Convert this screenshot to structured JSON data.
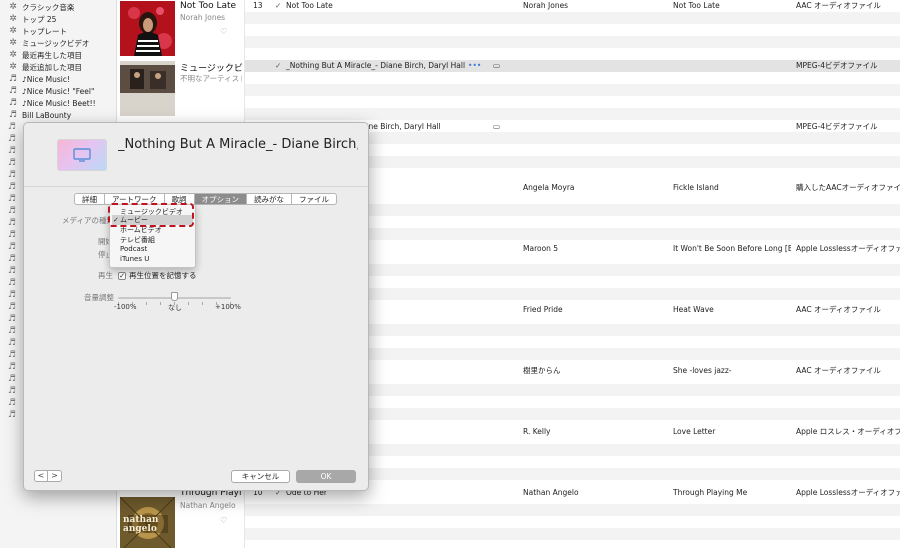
{
  "sidebar": {
    "items": [
      {
        "label": "クラシック音楽",
        "icon": "gear-icon"
      },
      {
        "label": "トップ 25",
        "icon": "gear-icon"
      },
      {
        "label": "トップレート",
        "icon": "gear-icon"
      },
      {
        "label": "ミュージックビデオ",
        "icon": "gear-icon"
      },
      {
        "label": "最近再生した項目",
        "icon": "gear-icon"
      },
      {
        "label": "最近追加した項目",
        "icon": "gear-icon"
      },
      {
        "label": "♪Nice Music!",
        "icon": "playlist-icon"
      },
      {
        "label": "♪Nice Music! \"Feel\"",
        "icon": "playlist-icon"
      },
      {
        "label": "♪Nice Music! Beet!!",
        "icon": "playlist-icon"
      },
      {
        "label": "Bill LaBounty",
        "icon": "playlist-icon"
      }
    ]
  },
  "albums": [
    {
      "title": "Not Too Late",
      "artist": "Norah Jones"
    },
    {
      "title": "ミュージックビデ...",
      "artist": "不明なアーティスト"
    },
    {
      "title": "Through Playin...",
      "artist": "Nathan Angelo",
      "cover_text": "nathan angelo"
    }
  ],
  "tracks": [
    {
      "num": "13",
      "check": "✓",
      "name": "Not Too Late",
      "icon": "",
      "artist": "Norah Jones",
      "album": "Not Too Late",
      "kind": "AAC オーディオファイル"
    },
    {
      "num": "",
      "check": "✓",
      "name": "_Nothing But A Miracle_- Diane Birch, Daryl Hall",
      "dots": "•••",
      "icon": "▭",
      "artist": "",
      "album": "",
      "kind": "MPEG-4ビデオファイル",
      "selected": true
    },
    {
      "num": "",
      "check": "",
      "name": "Diane Birch, Daryl Hall",
      "icon": "▭",
      "artist": "",
      "album": "",
      "kind": "MPEG-4ビデオファイル"
    },
    {
      "num": "",
      "check": "",
      "name": "",
      "icon": "",
      "artist": "Angela Moyra",
      "album": "Fickle Island",
      "kind": "購入したAACオーディオファイル"
    },
    {
      "num": "",
      "check": "",
      "name": "",
      "icon": "",
      "artist": "Maroon 5",
      "album": "It Won't Be Soon Before Long [Bo...",
      "kind": "Apple Losslessオーディオファイル"
    },
    {
      "num": "",
      "check": "",
      "name": "",
      "icon": "",
      "artist": "Fried Pride",
      "album": "Heat Wave",
      "kind": "AAC オーディオファイル"
    },
    {
      "num": "",
      "check": "",
      "name": "",
      "icon": "",
      "artist": "樹里からん",
      "album": "She -loves jazz-",
      "kind": "AAC オーディオファイル"
    },
    {
      "num": "",
      "check": "",
      "name": "",
      "icon": "",
      "artist": "R. Kelly",
      "album": "Love Letter",
      "kind": "Apple ロスレス・オーディオファイル"
    },
    {
      "num": "10",
      "check": "✓",
      "name": "Ode to Her",
      "icon": "",
      "artist": "Nathan Angelo",
      "album": "Through Playing Me",
      "kind": "Apple Losslessオーディオファイル"
    }
  ],
  "dialog": {
    "title": "_Nothing But A Miracle_- Diane Birch, Daryl H...",
    "tabs": [
      "詳細",
      "アートワーク",
      "歌詞",
      "オプション",
      "読みがな",
      "ファイル"
    ],
    "active_tab": 3,
    "labels": {
      "media_kind": "メディアの種類",
      "start": "開始",
      "stop": "停止",
      "playback": "再生",
      "volume": "音量調整"
    },
    "remember_position": "再生位置を記憶する",
    "remember_checked": "✓",
    "volume_value": 50,
    "slider_labels": [
      "-100%",
      "なし",
      "+100%"
    ],
    "cancel_label": "キャンセル",
    "ok_label": "OK",
    "prev_glyph": "<",
    "next_glyph": ">"
  },
  "media_menu": {
    "items": [
      "ミュージックビデオ",
      "ムービー",
      "ホームビデオ",
      "テレビ番組",
      "Podcast",
      "iTunes U"
    ],
    "selected": "ムービー",
    "check_glyph": "✓"
  },
  "colors": {
    "highlight": "#c1121f",
    "active_tab": "#8c8c8c",
    "ok_button": "#a8a8a8",
    "selection_dots": "#3a7bd5"
  }
}
